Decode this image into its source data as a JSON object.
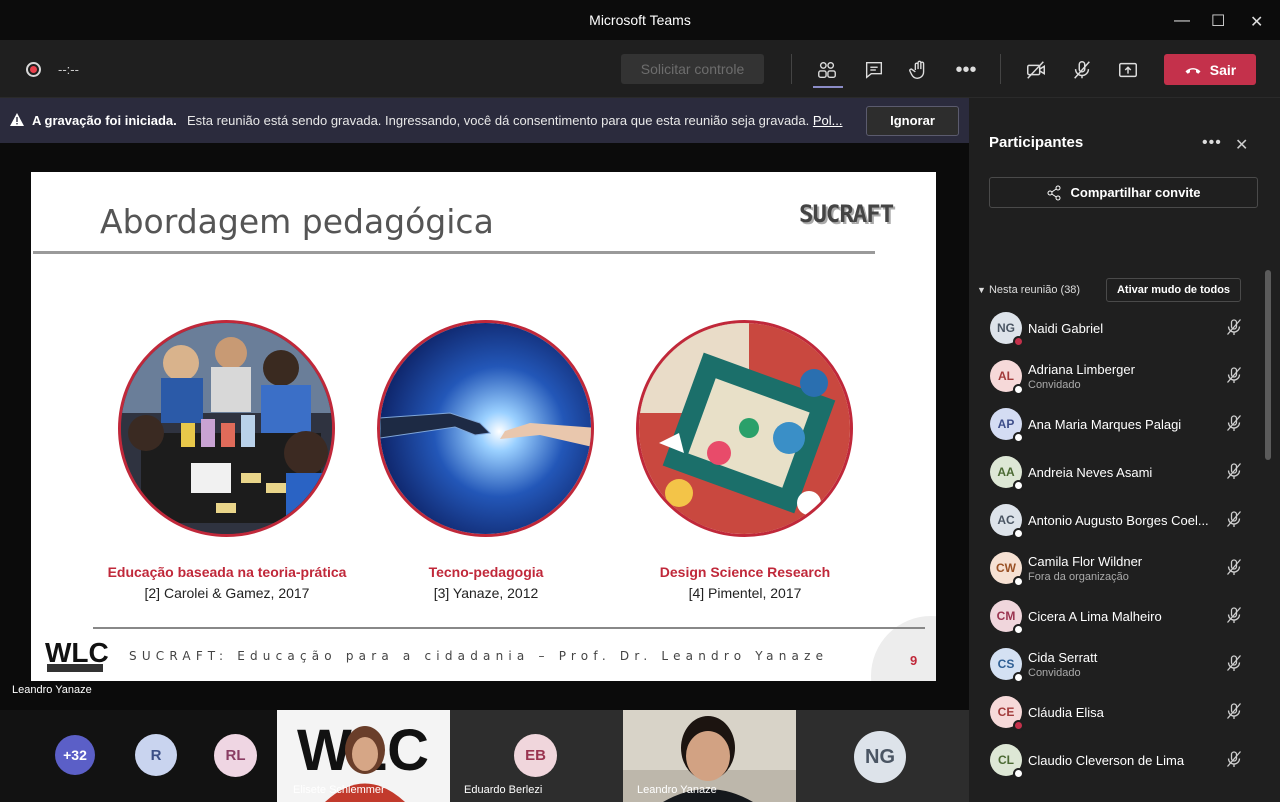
{
  "window": {
    "title": "Microsoft Teams"
  },
  "toolbar": {
    "timer": "--:--",
    "request_control": "Solicitar controle",
    "leave": "Sair",
    "leave_color": "#c4314b"
  },
  "banner": {
    "title": "A gravação foi iniciada.",
    "text": "Esta reunião está sendo gravada. Ingressando, você dá consentimento para que esta reunião seja gravada.",
    "link": "Pol...",
    "dismiss": "Ignorar"
  },
  "slide": {
    "title": "Abordagem pedagógica",
    "logo": "SUCRAFT",
    "items": [
      {
        "title": "Educação baseada na teoria-prática",
        "ref": "[2] Carolei & Gamez, 2017"
      },
      {
        "title": "Tecno-pedagogia",
        "ref": "[3] Yanaze, 2012"
      },
      {
        "title": "Design Science Research",
        "ref": "[4] Pimentel, 2017"
      }
    ],
    "footer": "SUCRAFT: Educação para a cidadania – Prof. Dr. Leandro Yanaze",
    "page": "9",
    "wlc_logo": "WLC"
  },
  "stage": {
    "presenter": "Leandro Yanaze"
  },
  "gallery": {
    "overflow": "+32",
    "avatars": [
      {
        "initials": "R",
        "bg": "#c9d4ef",
        "fg": "#3b4f86"
      },
      {
        "initials": "RL",
        "bg": "#efd6e3",
        "fg": "#8a3d63"
      }
    ],
    "tiles": [
      {
        "name": "Elisete Schlemmer"
      },
      {
        "name": "Eduardo Berlezi",
        "initials": "EB"
      },
      {
        "name": "Leandro Yanaze"
      },
      {
        "initials": "NG"
      }
    ]
  },
  "panel": {
    "title": "Participantes",
    "share": "Compartilhar convite",
    "section": "Nesta reunião (38)",
    "mute_all": "Ativar mudo de todos",
    "participants": [
      {
        "initials": "NG",
        "name": "Naidi Gabriel",
        "sub": "",
        "status": "#c4314b",
        "bg": "#dde3ea",
        "fg": "#4a5563"
      },
      {
        "initials": "AL",
        "name": "Adriana Limberger",
        "sub": "Convidado",
        "status": "#ffffff",
        "bg": "#f6d9d9",
        "fg": "#a23b3b"
      },
      {
        "initials": "AP",
        "name": "Ana Maria Marques Palagi",
        "sub": "",
        "status": "#ffffff",
        "bg": "#d4dcf3",
        "fg": "#3e4e8a"
      },
      {
        "initials": "AA",
        "name": "Andreia Neves Asami",
        "sub": "",
        "status": "#ffffff",
        "bg": "#dde7d5",
        "fg": "#4b6a33"
      },
      {
        "initials": "AC",
        "name": "Antonio Augusto Borges Coel...",
        "sub": "",
        "status": "#ffffff",
        "bg": "#dde3ea",
        "fg": "#4a5563"
      },
      {
        "initials": "CW",
        "name": "Camila Flor Wildner",
        "sub": "Fora da organização",
        "status": "#ffffff",
        "bg": "#f6e1d3",
        "fg": "#9a5125"
      },
      {
        "initials": "CM",
        "name": "Cicera A Lima Malheiro",
        "sub": "",
        "status": "#ffffff",
        "bg": "#f0d6dc",
        "fg": "#9a3450"
      },
      {
        "initials": "CS",
        "name": "Cida Serratt",
        "sub": "Convidado",
        "status": "#ffffff",
        "bg": "#d4e1f3",
        "fg": "#2f5f94"
      },
      {
        "initials": "CE",
        "name": "Cláudia Elisa",
        "sub": "",
        "status": "#c4314b",
        "bg": "#f6d9d9",
        "fg": "#a23b3b"
      },
      {
        "initials": "CL",
        "name": "Claudio Cleverson de Lima",
        "sub": "",
        "status": "#ffffff",
        "bg": "#dde7d5",
        "fg": "#4b6a33"
      }
    ]
  }
}
